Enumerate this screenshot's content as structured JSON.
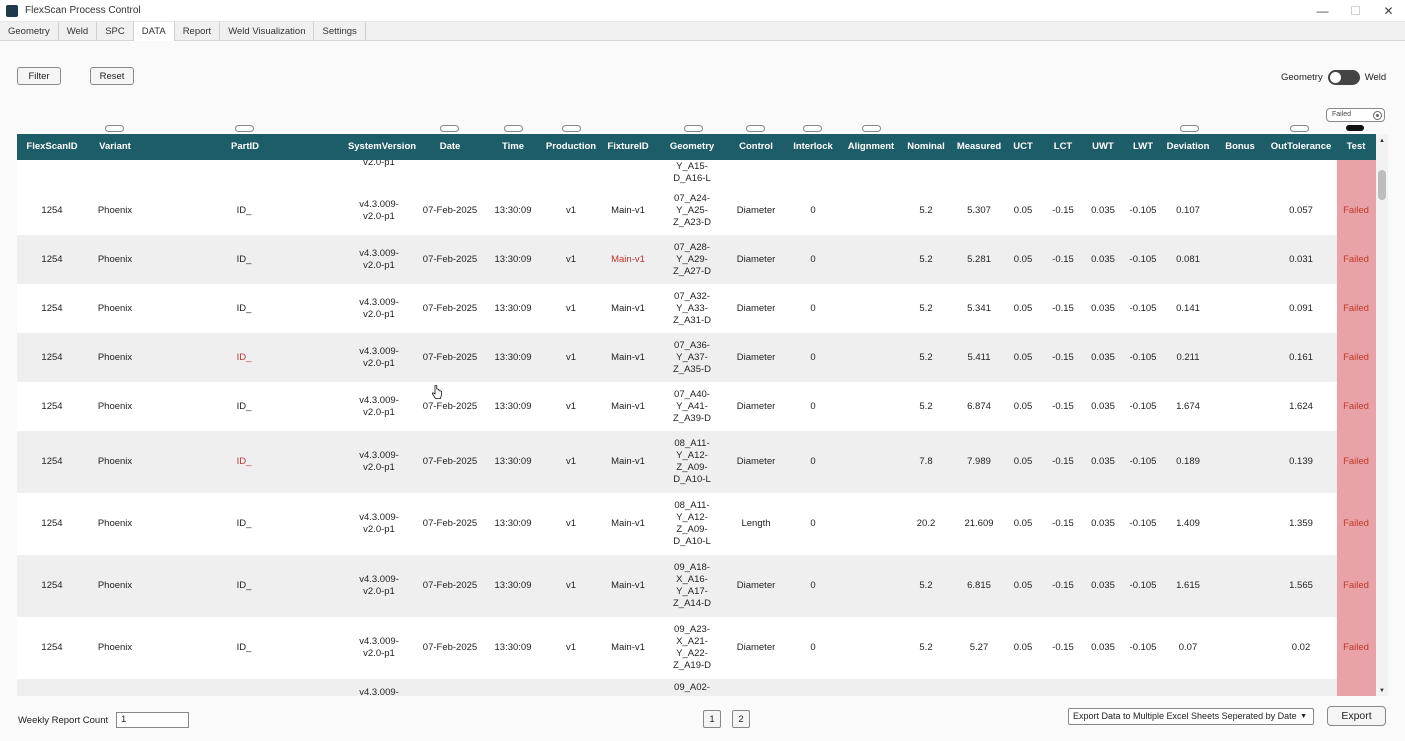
{
  "window": {
    "title": "FlexScan Process Control",
    "minimize": "—",
    "maximize": "☐",
    "close": "✕"
  },
  "tabs": [
    "Geometry",
    "Weld",
    "SPC",
    "DATA",
    "Report",
    "Weld Visualization",
    "Settings"
  ],
  "toolbar": {
    "filter_label": "Filter",
    "reset_label": "Reset"
  },
  "view_toggle": {
    "left_label": "Geometry",
    "right_label": "Weld"
  },
  "test_filter": {
    "value": "Failed"
  },
  "columns": [
    "FlexScanID",
    "Variant",
    "PartID",
    "SystemVersion",
    "Date",
    "Time",
    "Production",
    "FixtureID",
    "Geometry",
    "Control",
    "Interlock",
    "Alignment",
    "Nominal",
    "Measured",
    "UCT",
    "LCT",
    "UWT",
    "LWT",
    "Deviation",
    "Bonus",
    "OutTolerance",
    "Test"
  ],
  "partial_top": {
    "version": "v2.0-p1",
    "geometry": [
      "Y_A15-",
      "D_A16-L"
    ]
  },
  "rows": [
    {
      "id": "1254",
      "variant": "Phoenix",
      "part": "ID_",
      "version": [
        "v4.3.009-",
        "v2.0-p1"
      ],
      "date": "07-Feb-2025",
      "time": "13:30:09",
      "production": "v1",
      "fixture": "Main-v1",
      "geometry": [
        "07_A24-",
        "Y_A25-",
        "Z_A23-D"
      ],
      "control": "Diameter",
      "interlock": "0",
      "nominal": "5.2",
      "measured": "5.307",
      "uct": "0.05",
      "lct": "-0.15",
      "uwt": "0.035",
      "lwt": "-0.105",
      "deviation": "0.107",
      "out": "0.057",
      "test": "Failed"
    },
    {
      "id": "1254",
      "variant": "Phoenix",
      "part": "ID_",
      "version": [
        "v4.3.009-",
        "v2.0-p1"
      ],
      "date": "07-Feb-2025",
      "time": "13:30:09",
      "production": "v1",
      "fixture": "Main-v1",
      "geometry": [
        "07_A28-",
        "Y_A29-",
        "Z_A27-D"
      ],
      "control": "Diameter",
      "interlock": "0",
      "nominal": "5.2",
      "measured": "5.281",
      "uct": "0.05",
      "lct": "-0.15",
      "uwt": "0.035",
      "lwt": "-0.105",
      "deviation": "0.081",
      "out": "0.031",
      "test": "Failed"
    },
    {
      "id": "1254",
      "variant": "Phoenix",
      "part": "ID_",
      "version": [
        "v4.3.009-",
        "v2.0-p1"
      ],
      "date": "07-Feb-2025",
      "time": "13:30:09",
      "production": "v1",
      "fixture": "Main-v1",
      "geometry": [
        "07_A32-",
        "Y_A33-",
        "Z_A31-D"
      ],
      "control": "Diameter",
      "interlock": "0",
      "nominal": "5.2",
      "measured": "5.341",
      "uct": "0.05",
      "lct": "-0.15",
      "uwt": "0.035",
      "lwt": "-0.105",
      "deviation": "0.141",
      "out": "0.091",
      "test": "Failed"
    },
    {
      "id": "1254",
      "variant": "Phoenix",
      "part": "ID_",
      "version": [
        "v4.3.009-",
        "v2.0-p1"
      ],
      "date": "07-Feb-2025",
      "time": "13:30:09",
      "production": "v1",
      "fixture": "Main-v1",
      "geometry": [
        "07_A36-",
        "Y_A37-",
        "Z_A35-D"
      ],
      "control": "Diameter",
      "interlock": "0",
      "nominal": "5.2",
      "measured": "5.411",
      "uct": "0.05",
      "lct": "-0.15",
      "uwt": "0.035",
      "lwt": "-0.105",
      "deviation": "0.211",
      "out": "0.161",
      "test": "Failed"
    },
    {
      "id": "1254",
      "variant": "Phoenix",
      "part": "ID_",
      "version": [
        "v4.3.009-",
        "v2.0-p1"
      ],
      "date": "07-Feb-2025",
      "time": "13:30:09",
      "production": "v1",
      "fixture": "Main-v1",
      "geometry": [
        "07_A40-",
        "Y_A41-",
        "Z_A39-D"
      ],
      "control": "Diameter",
      "interlock": "0",
      "nominal": "5.2",
      "measured": "6.874",
      "uct": "0.05",
      "lct": "-0.15",
      "uwt": "0.035",
      "lwt": "-0.105",
      "deviation": "1.674",
      "out": "1.624",
      "test": "Failed"
    },
    {
      "id": "1254",
      "variant": "Phoenix",
      "part": "ID_",
      "version": [
        "v4.3.009-",
        "v2.0-p1"
      ],
      "date": "07-Feb-2025",
      "time": "13:30:09",
      "production": "v1",
      "fixture": "Main-v1",
      "geometry": [
        "08_A11-",
        "Y_A12-",
        "Z_A09-",
        "D_A10-L"
      ],
      "control": "Diameter",
      "interlock": "0",
      "nominal": "7.8",
      "measured": "7.989",
      "uct": "0.05",
      "lct": "-0.15",
      "uwt": "0.035",
      "lwt": "-0.105",
      "deviation": "0.189",
      "out": "0.139",
      "test": "Failed"
    },
    {
      "id": "1254",
      "variant": "Phoenix",
      "part": "ID_",
      "version": [
        "v4.3.009-",
        "v2.0-p1"
      ],
      "date": "07-Feb-2025",
      "time": "13:30:09",
      "production": "v1",
      "fixture": "Main-v1",
      "geometry": [
        "08_A11-",
        "Y_A12-",
        "Z_A09-",
        "D_A10-L"
      ],
      "control": "Length",
      "interlock": "0",
      "nominal": "20.2",
      "measured": "21.609",
      "uct": "0.05",
      "lct": "-0.15",
      "uwt": "0.035",
      "lwt": "-0.105",
      "deviation": "1.409",
      "out": "1.359",
      "test": "Failed"
    },
    {
      "id": "1254",
      "variant": "Phoenix",
      "part": "ID_",
      "version": [
        "v4.3.009-",
        "v2.0-p1"
      ],
      "date": "07-Feb-2025",
      "time": "13:30:09",
      "production": "v1",
      "fixture": "Main-v1",
      "geometry": [
        "09_A18-",
        "X_A16-",
        "Y_A17-",
        "Z_A14-D"
      ],
      "control": "Diameter",
      "interlock": "0",
      "nominal": "5.2",
      "measured": "6.815",
      "uct": "0.05",
      "lct": "-0.15",
      "uwt": "0.035",
      "lwt": "-0.105",
      "deviation": "1.615",
      "out": "1.565",
      "test": "Failed"
    },
    {
      "id": "1254",
      "variant": "Phoenix",
      "part": "ID_",
      "version": [
        "v4.3.009-",
        "v2.0-p1"
      ],
      "date": "07-Feb-2025",
      "time": "13:30:09",
      "production": "v1",
      "fixture": "Main-v1",
      "geometry": [
        "09_A23-",
        "X_A21-",
        "Y_A22-",
        "Z_A19-D"
      ],
      "control": "Diameter",
      "interlock": "0",
      "nominal": "5.2",
      "measured": "5.27",
      "uct": "0.05",
      "lct": "-0.15",
      "uwt": "0.035",
      "lwt": "-0.105",
      "deviation": "0.07",
      "out": "0.02",
      "test": "Failed"
    }
  ],
  "partial_bottom": {
    "version": "v4.3.009-",
    "geometry": "09_A02-"
  },
  "footer": {
    "weekly_label": "Weekly Report Count",
    "weekly_value": "1",
    "pages": [
      "1",
      "2"
    ],
    "export_option": "Export Data to Multiple Excel Sheets Seperated by Date",
    "export_label": "Export"
  }
}
